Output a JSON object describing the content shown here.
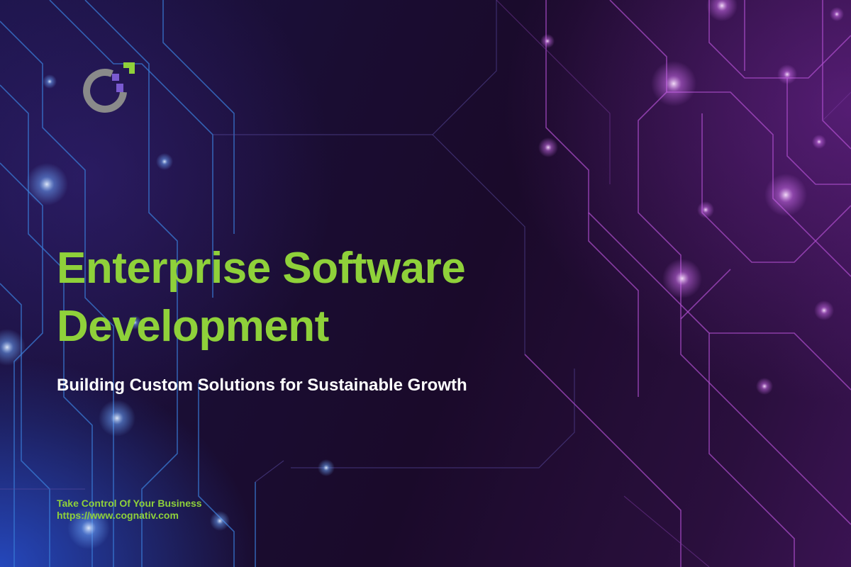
{
  "hero": {
    "title_line1": "Enterprise Software",
    "title_line2": "Development",
    "subtitle": "Building Custom Solutions for Sustainable Growth"
  },
  "footer": {
    "tagline": "Take Control Of Your Business",
    "url": "https://www.cognativ.com"
  },
  "logo": {
    "icon": "cognativ-logo-icon"
  },
  "colors": {
    "accent_green": "#8fd13a",
    "subtitle_white": "#ffffff",
    "circuit_blue": "#3a7bd5",
    "circuit_purple": "#b050d0",
    "logo_gray": "#8a8a8a",
    "logo_purple": "#7a5ad0"
  }
}
